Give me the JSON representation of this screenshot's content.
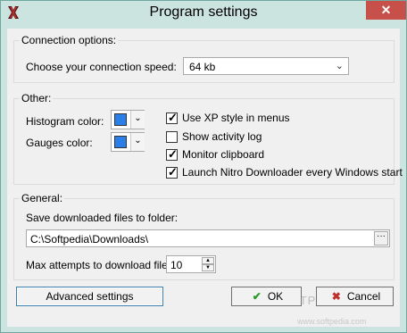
{
  "window": {
    "title": "Program settings",
    "close_glyph": "✕",
    "app_icon": "x-mark-app-icon"
  },
  "connection": {
    "group_label": "Connection options:",
    "speed_label": "Choose your connection speed:",
    "speed_value": "64 kb"
  },
  "other": {
    "group_label": "Other:",
    "histogram_label": "Histogram color:",
    "histogram_color": "#2a7fe8",
    "gauges_label": "Gauges color:",
    "gauges_color": "#2a7fe8",
    "checks": [
      {
        "label": "Use XP style in menus",
        "checked": true
      },
      {
        "label": "Show activity log",
        "checked": false
      },
      {
        "label": "Monitor clipboard",
        "checked": true
      },
      {
        "label": "Launch Nitro Downloader every Windows start",
        "checked": true
      }
    ]
  },
  "general": {
    "group_label": "General:",
    "folder_label": "Save downloaded files to folder:",
    "folder_value": "C:\\Softpedia\\Downloads\\",
    "attempts_label": "Max attempts to download file:",
    "attempts_value": "10"
  },
  "buttons": {
    "advanced": "Advanced settings",
    "ok": "OK",
    "cancel": "Cancel"
  },
  "watermark": {
    "text": "SOFTPEDIA",
    "url": "www.softpedia.com"
  }
}
